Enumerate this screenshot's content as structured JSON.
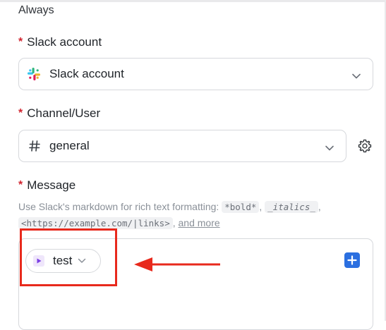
{
  "section": {
    "condition_label": "Always"
  },
  "slack_account": {
    "label": "Slack account",
    "required_mark": "*",
    "selected_value": "Slack account"
  },
  "channel": {
    "label": "Channel/User",
    "required_mark": "*",
    "selected_value": "general"
  },
  "message": {
    "label": "Message",
    "required_mark": "*",
    "hint_prefix": "Use Slack's markdown for rich text formatting:",
    "hint_bold": "*bold*",
    "hint_italics": "_italics_",
    "hint_link": "<https://example.com/|links>",
    "hint_more": "and more",
    "token_label": "test"
  },
  "colors": {
    "required": "#d1242f",
    "accent_blue": "#2b6fe0",
    "highlight_red": "#e8291c",
    "token_purple": "#7b3fe4"
  },
  "icons": {
    "account": "slack-logo-icon",
    "channel": "hash-icon",
    "settings": "gear-icon",
    "token": "play-icon",
    "add": "plus-icon",
    "dropdown": "chevron-down-icon"
  }
}
